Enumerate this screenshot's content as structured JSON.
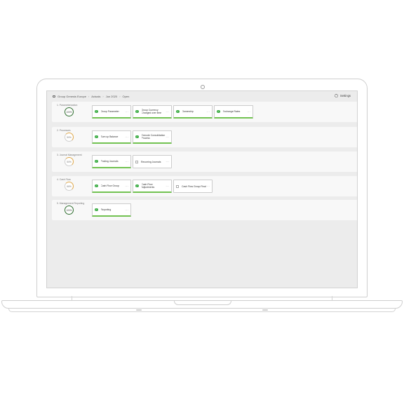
{
  "breadcrumb": [
    "Group Genesis Europe",
    "Actuals",
    "Jun 2020",
    "Open"
  ],
  "settings_label": "Settings",
  "stages": [
    {
      "title": "1. Parameterization",
      "progress": "100%",
      "state": "done",
      "tasks": [
        {
          "label": "Group Parameter",
          "status": "complete"
        },
        {
          "label": "Group Currency Changed over time",
          "status": "complete"
        },
        {
          "label": "Ownership",
          "status": "complete"
        },
        {
          "label": "Exchange Rates",
          "status": "complete"
        }
      ]
    },
    {
      "title": "2.    Processes",
      "progress": "50%",
      "state": "partial",
      "tasks": [
        {
          "label": "Sum up Balance",
          "status": "complete"
        },
        {
          "label": "Execute Consolidation Process",
          "status": "complete"
        }
      ]
    },
    {
      "title": "3. Journal Management",
      "progress": "50%",
      "state": "partial",
      "tasks": [
        {
          "label": "Posting Journals",
          "status": "complete"
        },
        {
          "label": "Recurring Journals",
          "status": "open"
        }
      ]
    },
    {
      "title": "4. Cash Flow",
      "progress": "66%",
      "state": "partial",
      "tasks": [
        {
          "label": "Cash Flow Group",
          "status": "complete"
        },
        {
          "label": "Cash Flow Adjustments",
          "status": "complete"
        },
        {
          "label": "Cash Flow Group Final",
          "status": "open"
        }
      ]
    },
    {
      "title": "5. Management Reporting",
      "progress": "100%",
      "state": "done",
      "tasks": [
        {
          "label": "Reporting",
          "status": "complete"
        }
      ]
    }
  ],
  "colors": {
    "complete": "#72c251",
    "done_ring": "#2f6e2f",
    "partial_ring": "#e0a84a"
  }
}
